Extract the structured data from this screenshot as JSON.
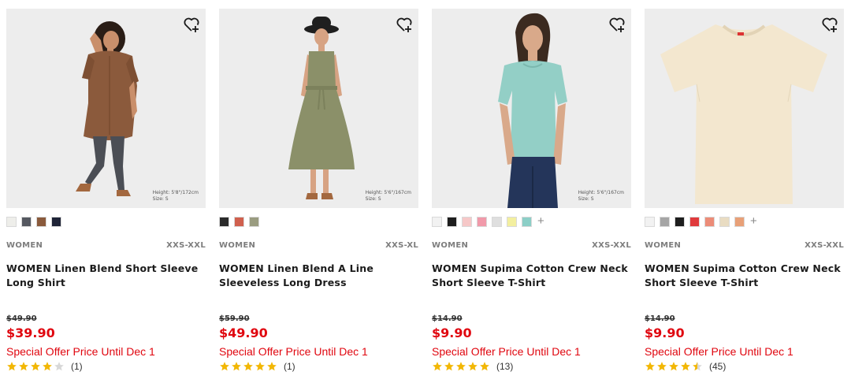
{
  "products": [
    {
      "gender": "WOMEN",
      "sizes": "XXS-XXL",
      "title": "WOMEN Linen Blend Short Sleeve Long Shirt",
      "original_price": "$49.90",
      "price": "$39.90",
      "offer": "Special Offer Price Until Dec 1",
      "rating": 4,
      "reviews": "(1)",
      "measure_height": "Height: 5'8\"/172cm",
      "measure_size": "Size: S",
      "colors": [
        "#eeeeea",
        "#555860",
        "#8a5a3c",
        "#1f2437"
      ],
      "more_colors": ""
    },
    {
      "gender": "WOMEN",
      "sizes": "XXS-XL",
      "title": "WOMEN Linen Blend A Line Sleeveless Long Dress",
      "original_price": "$59.90",
      "price": "$49.90",
      "offer": "Special Offer Price Until Dec 1",
      "rating": 5,
      "reviews": "(1)",
      "measure_height": "Height: 5'6\"/167cm",
      "measure_size": "Size: S",
      "colors": [
        "#2b2b2b",
        "#d0604e",
        "#9a9c80"
      ],
      "more_colors": ""
    },
    {
      "gender": "WOMEN",
      "sizes": "XXS-XXL",
      "title": "WOMEN Supima Cotton Crew Neck Short Sleeve T-Shirt",
      "original_price": "$14.90",
      "price": "$9.90",
      "offer": "Special Offer Price Until Dec 1",
      "rating": 5,
      "reviews": "(13)",
      "measure_height": "Height: 5'6\"/167cm",
      "measure_size": "Size: S",
      "colors": [
        "#f2f2f2",
        "#1e1e1e",
        "#f6c8c8",
        "#f19aaa",
        "#dfdfdf",
        "#f3ef9f",
        "#8ccfc7"
      ],
      "more_colors": "+"
    },
    {
      "gender": "WOMEN",
      "sizes": "XXS-XXL",
      "title": "WOMEN Supima Cotton Crew Neck Short Sleeve T-Shirt",
      "original_price": "$14.90",
      "price": "$9.90",
      "offer": "Special Offer Price Until Dec 1",
      "rating": 4.5,
      "reviews": "(45)",
      "measure_height": "",
      "measure_size": "",
      "colors": [
        "#f2f2f2",
        "#a5a5a5",
        "#1e1e1e",
        "#e03a3c",
        "#ec8c78",
        "#e9dcc2",
        "#e8a078"
      ],
      "more_colors": "+"
    }
  ],
  "accent_color": "#e0060f",
  "star_color": "#f2b705",
  "icons": {
    "wishlist": "heart-plus-icon",
    "rating": "star-icon"
  }
}
